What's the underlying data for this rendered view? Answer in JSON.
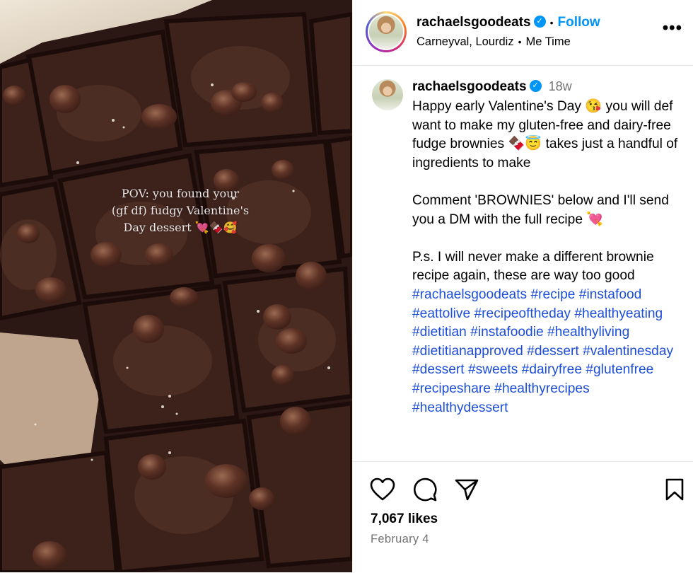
{
  "media": {
    "overlay_lines": [
      "POV: you found your",
      "(gf df) fudgy Valentine's",
      "Day dessert 💘🍫🥰"
    ]
  },
  "header": {
    "username": "rachaelsgoodeats",
    "follow_label": "Follow",
    "audio": "Carneyval, Lourdiz",
    "audio_track": "Me Time",
    "more_label": "•••"
  },
  "caption": {
    "username": "rachaelsgoodeats",
    "time_ago": "18w",
    "paragraph1": "Happy early Valentine's Day 😘 you will def want to make my gluten-free and dairy-free fudge brownies 🍫😇 takes just a handful of ingredients to make",
    "paragraph2": "Comment 'BROWNIES' below and I'll send you a DM with the full recipe 💘",
    "paragraph3": "P.s. I will never make a different brownie recipe again, these are way too good",
    "hashtags": [
      "#rachaelsgoodeats",
      "#recipe",
      "#instafood",
      "#eattolive",
      "#recipeoftheday",
      "#healthyeating",
      "#dietitian",
      "#instafoodie",
      "#healthyliving",
      "#dietitianapproved",
      "#dessert",
      "#valentinesday",
      "#dessert",
      "#sweets",
      "#dairyfree",
      "#glutenfree",
      "#recipeshare",
      "#healthyrecipes",
      "#healthydessert"
    ]
  },
  "actions": {
    "likes": "7,067 likes",
    "date": "February 4"
  },
  "icons": {
    "verified": "verified-badge-icon",
    "like": "heart-icon",
    "comment": "comment-bubble-icon",
    "share": "paper-plane-icon",
    "save": "bookmark-icon"
  },
  "colors": {
    "link": "#0095f6",
    "hashtag": "#1d4ed8",
    "muted": "#737373"
  }
}
